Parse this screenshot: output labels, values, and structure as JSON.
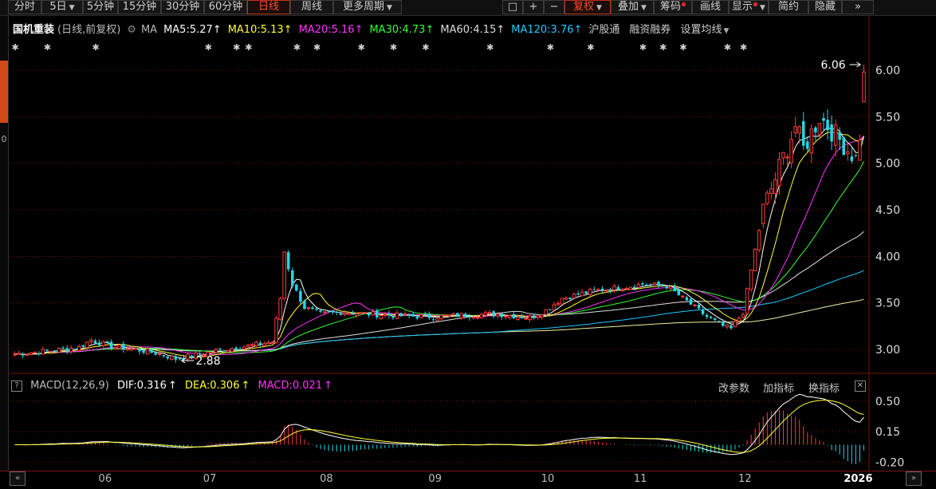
{
  "toolbar": {
    "periods": [
      {
        "label": "分时",
        "arrow": false
      },
      {
        "label": "5日",
        "arrow": true
      },
      {
        "label": "5分钟",
        "arrow": false
      },
      {
        "label": "15分钟",
        "arrow": false
      },
      {
        "label": "30分钟",
        "arrow": false
      },
      {
        "label": "60分钟",
        "arrow": false
      },
      {
        "label": "日线",
        "arrow": false,
        "active": true
      },
      {
        "label": "周线",
        "arrow": false
      },
      {
        "label": "更多周期",
        "arrow": true
      }
    ],
    "right": [
      {
        "label": "□",
        "arrow": false
      },
      {
        "label": "+",
        "arrow": false
      },
      {
        "label": "−",
        "arrow": false
      },
      {
        "label": "复权",
        "arrow": true,
        "active": true
      },
      {
        "label": "叠加",
        "arrow": true
      },
      {
        "label": "筹码",
        "dot": true
      },
      {
        "label": "画线",
        "arrow": false
      },
      {
        "label": "显示",
        "arrow": true,
        "dot": true
      },
      {
        "label": "简约",
        "arrow": false
      },
      {
        "label": "隐藏",
        "arrow": false
      },
      {
        "label": "»",
        "arrow": false
      }
    ]
  },
  "sidebar": {
    "chars": [
      "0"
    ]
  },
  "legend": {
    "name": "国机重装",
    "mode": "(日线,前复权)",
    "ma_label": "MA",
    "ma5": "MA5:5.27",
    "ma10": "MA10:5.13",
    "ma20": "MA20:5.16",
    "ma30": "MA30:4.73",
    "ma60": "MA60:4.15",
    "ma120": "MA120:3.76",
    "hgt": "沪股通",
    "rzrq": "融资融券",
    "setma": "设置均线"
  },
  "colors": {
    "up": "#ff3b3b",
    "down": "#23d7e6",
    "ma5": "#ffffff",
    "ma10": "#ffff33",
    "ma20": "#ff33ff",
    "ma30": "#33ff33",
    "ma60": "#dddddd",
    "ma120": "#1ec8ff",
    "ma250": "#f0f0a0",
    "grid": "#7a1515",
    "axis": "#7a1515"
  },
  "markers": {
    "high": "6.06",
    "low": "2.88"
  },
  "macd_legend": {
    "title": "MACD(12,26,9)",
    "dif": "DIF:0.316",
    "dea": "DEA:0.306",
    "macd": "MACD:0.021",
    "btn1": "改参数",
    "btn2": "加指标",
    "btn3": "换指标"
  },
  "chart_data": [
    {
      "type": "candlestick",
      "title": "国机重装 日线 前复权",
      "ylim": [
        2.85,
        6.1
      ],
      "yticks": [
        "6.00",
        "5.50",
        "5.00",
        "4.50",
        "4.00",
        "3.50",
        "3.00"
      ],
      "ytick_values": [
        6.0,
        5.5,
        5.0,
        4.5,
        4.0,
        3.5,
        3.0
      ],
      "x_labels": [
        "06",
        "07",
        "08",
        "09",
        "10",
        "11",
        "12",
        "2026"
      ],
      "x_label_index": [
        22,
        48,
        77,
        104,
        132,
        155,
        181,
        208
      ],
      "n_bars": 212,
      "high": 6.06,
      "low": 2.88,
      "ma_latest": {
        "MA5": 5.27,
        "MA10": 5.13,
        "MA20": 5.16,
        "MA30": 4.73,
        "MA60": 4.15,
        "MA120": 3.76
      },
      "anchors": [
        [
          0,
          2.95
        ],
        [
          8,
          2.98
        ],
        [
          16,
          3.02
        ],
        [
          19,
          3.1
        ],
        [
          24,
          3.03
        ],
        [
          30,
          3.0
        ],
        [
          36,
          2.95
        ],
        [
          40,
          2.9
        ],
        [
          44,
          2.93
        ],
        [
          52,
          3.0
        ],
        [
          60,
          3.05
        ],
        [
          64,
          3.08
        ],
        [
          66,
          3.55
        ],
        [
          67,
          4.05
        ],
        [
          69,
          3.7
        ],
        [
          72,
          3.45
        ],
        [
          76,
          3.38
        ],
        [
          82,
          3.4
        ],
        [
          88,
          3.38
        ],
        [
          96,
          3.36
        ],
        [
          104,
          3.35
        ],
        [
          112,
          3.37
        ],
        [
          120,
          3.38
        ],
        [
          128,
          3.34
        ],
        [
          132,
          3.42
        ],
        [
          136,
          3.55
        ],
        [
          144,
          3.63
        ],
        [
          150,
          3.66
        ],
        [
          156,
          3.7
        ],
        [
          162,
          3.68
        ],
        [
          166,
          3.55
        ],
        [
          172,
          3.35
        ],
        [
          176,
          3.25
        ],
        [
          178,
          3.22
        ],
        [
          181,
          3.4
        ],
        [
          183,
          3.85
        ],
        [
          186,
          4.5
        ],
        [
          190,
          4.95
        ],
        [
          194,
          5.4
        ],
        [
          196,
          5.15
        ],
        [
          200,
          5.5
        ],
        [
          204,
          5.3
        ],
        [
          208,
          5.1
        ],
        [
          210,
          5.0
        ],
        [
          213,
          5.25
        ],
        [
          214,
          6.0
        ]
      ]
    },
    {
      "type": "macd",
      "yticks": [
        "0.50",
        "0.15",
        "-0.20"
      ],
      "ytick_values": [
        0.5,
        0.15,
        -0.2
      ],
      "ylim": [
        -0.26,
        0.58
      ],
      "dif": 0.316,
      "dea": 0.306,
      "macd": 0.021
    }
  ]
}
